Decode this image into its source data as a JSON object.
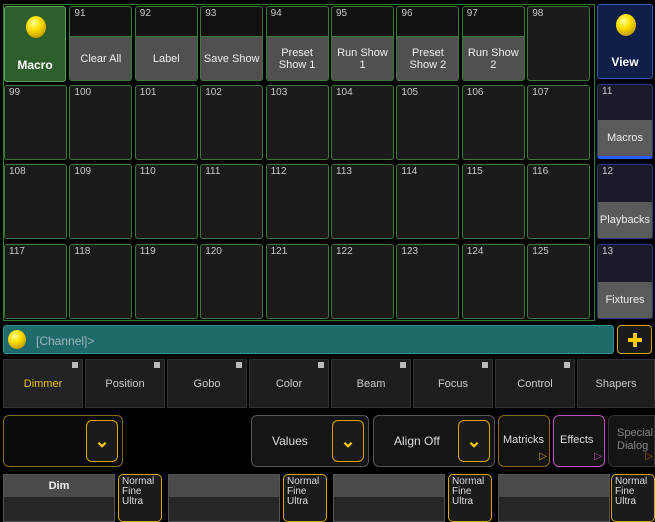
{
  "macro_pool": {
    "title": "Macro",
    "cells": [
      {
        "num": "91",
        "label": "Clear All"
      },
      {
        "num": "92",
        "label": "Label"
      },
      {
        "num": "93",
        "label": "Save Show"
      },
      {
        "num": "94",
        "label": "Preset Show 1"
      },
      {
        "num": "95",
        "label": "Run Show 1"
      },
      {
        "num": "96",
        "label": "Preset Show 2"
      },
      {
        "num": "97",
        "label": "Run Show 2"
      },
      {
        "num": "98",
        "label": ""
      },
      {
        "num": "99",
        "label": ""
      },
      {
        "num": "100",
        "label": ""
      },
      {
        "num": "101",
        "label": ""
      },
      {
        "num": "102",
        "label": ""
      },
      {
        "num": "103",
        "label": ""
      },
      {
        "num": "104",
        "label": ""
      },
      {
        "num": "105",
        "label": ""
      },
      {
        "num": "106",
        "label": ""
      },
      {
        "num": "107",
        "label": ""
      },
      {
        "num": "108",
        "label": ""
      },
      {
        "num": "109",
        "label": ""
      },
      {
        "num": "110",
        "label": ""
      },
      {
        "num": "111",
        "label": ""
      },
      {
        "num": "112",
        "label": ""
      },
      {
        "num": "113",
        "label": ""
      },
      {
        "num": "114",
        "label": ""
      },
      {
        "num": "115",
        "label": ""
      },
      {
        "num": "116",
        "label": ""
      },
      {
        "num": "117",
        "label": ""
      },
      {
        "num": "118",
        "label": ""
      },
      {
        "num": "119",
        "label": ""
      },
      {
        "num": "120",
        "label": ""
      },
      {
        "num": "121",
        "label": ""
      },
      {
        "num": "122",
        "label": ""
      },
      {
        "num": "123",
        "label": ""
      },
      {
        "num": "124",
        "label": ""
      },
      {
        "num": "125",
        "label": ""
      }
    ]
  },
  "view_pool": {
    "title": "View",
    "items": [
      {
        "num": "11",
        "label": "Macros"
      },
      {
        "num": "12",
        "label": "Playbacks"
      },
      {
        "num": "13",
        "label": "Fixtures"
      }
    ]
  },
  "command_line": {
    "text": "[Channel]>"
  },
  "tabs": [
    "Dimmer",
    "Position",
    "Gobo",
    "Color",
    "Beam",
    "Focus",
    "Control",
    "Shapers"
  ],
  "controls": {
    "values_label": "Values",
    "align_label": "Align Off",
    "matricks_label": "Matricks",
    "effects_label": "Effects",
    "special_label_1": "Special",
    "special_label_2": "Dialog"
  },
  "faders": {
    "dim_label": "Dim",
    "mode_lines": [
      "Normal",
      "Fine",
      "Ultra"
    ]
  }
}
